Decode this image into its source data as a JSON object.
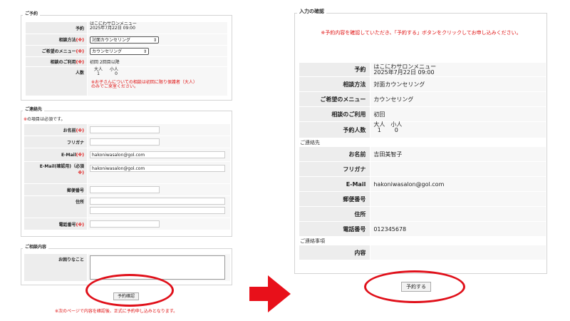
{
  "left": {
    "booking": {
      "legend": "ご予約",
      "rows": {
        "plan": {
          "label": "予約",
          "line1": "はこにわサロンメニュー",
          "line2": "2025年7月22日 09:00"
        },
        "method": {
          "label": "相談方法",
          "req": "(※)",
          "value": "対面カウンセリング"
        },
        "menu": {
          "label": "ご希望のメニュー",
          "req": "(※)",
          "value": "カウンセリング"
        },
        "usage": {
          "label": "相談のご利用",
          "req": "(※)",
          "value": "初回 2回目以降"
        },
        "people": {
          "label": "人数",
          "adult_label": "大人",
          "adult_value": "1",
          "child_label": "小人",
          "child_value": "0",
          "note": "※お子さんについての相談は初回に限り保護者（大人）のみでご来室ください。"
        }
      }
    },
    "contact": {
      "legend": "ご連絡先",
      "required_note_mark": "※",
      "required_note_text": "の項目は必須です。",
      "rows": {
        "name": {
          "label": "お名前",
          "req": "(※)",
          "value": ""
        },
        "kana": {
          "label": "フリガナ",
          "value": ""
        },
        "email": {
          "label": "E-Mail",
          "req": "(※)",
          "value": "hakoniwasalon@gol.com"
        },
        "email_confirm": {
          "label": "E-Mail(確認用)（必須",
          "req": "※)",
          "value": "hakoniwasalon@gol.com"
        },
        "postal": {
          "label": "郵便番号",
          "value": ""
        },
        "address": {
          "label": "住所",
          "value": ""
        },
        "phone": {
          "label": "電話番号",
          "req": "(※)",
          "value": ""
        }
      }
    },
    "consult": {
      "legend": "ご相談内容",
      "rows": {
        "concern": {
          "label": "お困りなこと",
          "value": ""
        }
      }
    },
    "confirm_button": "予約確認",
    "bottom_note": "※次のページで内容を確認後、正式に予約申し込みとなります。"
  },
  "right": {
    "legend": "入力の確認",
    "notice": "※予約内容を確認していただき、「予約する」ボタンをクリックしてお申し込みください。",
    "rows": {
      "plan": {
        "label": "予約",
        "line1": "はこにわサロンメニュー",
        "line2": "2025年7月22日 09:00"
      },
      "method": {
        "label": "相談方法",
        "value": "対面カウンセリング"
      },
      "menu": {
        "label": "ご希望のメニュー",
        "value": "カウンセリング"
      },
      "usage": {
        "label": "相談のご利用",
        "value": "初回"
      },
      "people": {
        "label": "予約人数",
        "adult_label": "大人",
        "adult_value": "1",
        "child_label": "小人",
        "child_value": "0"
      },
      "contact_section": "ご連絡先",
      "name": {
        "label": "お名前",
        "value": "吉田美智子"
      },
      "kana": {
        "label": "フリガナ",
        "value": ""
      },
      "email": {
        "label": "E-Mail",
        "value": "hakoniwasalon@gol.com"
      },
      "postal": {
        "label": "郵便番号",
        "value": ""
      },
      "address": {
        "label": "住所",
        "value": ""
      },
      "phone": {
        "label": "電話番号",
        "value": "012345678"
      },
      "notes_section": "ご連絡事項",
      "content": {
        "label": "内容",
        "value": ""
      }
    },
    "submit_button": "予約する"
  },
  "colors": {
    "accent_red": "#e01010",
    "oval_red": "#e0101a",
    "arrow_red": "#e8101a"
  },
  "icons": {
    "arrow": "right-arrow-icon",
    "select": "select-chevron-icon"
  }
}
